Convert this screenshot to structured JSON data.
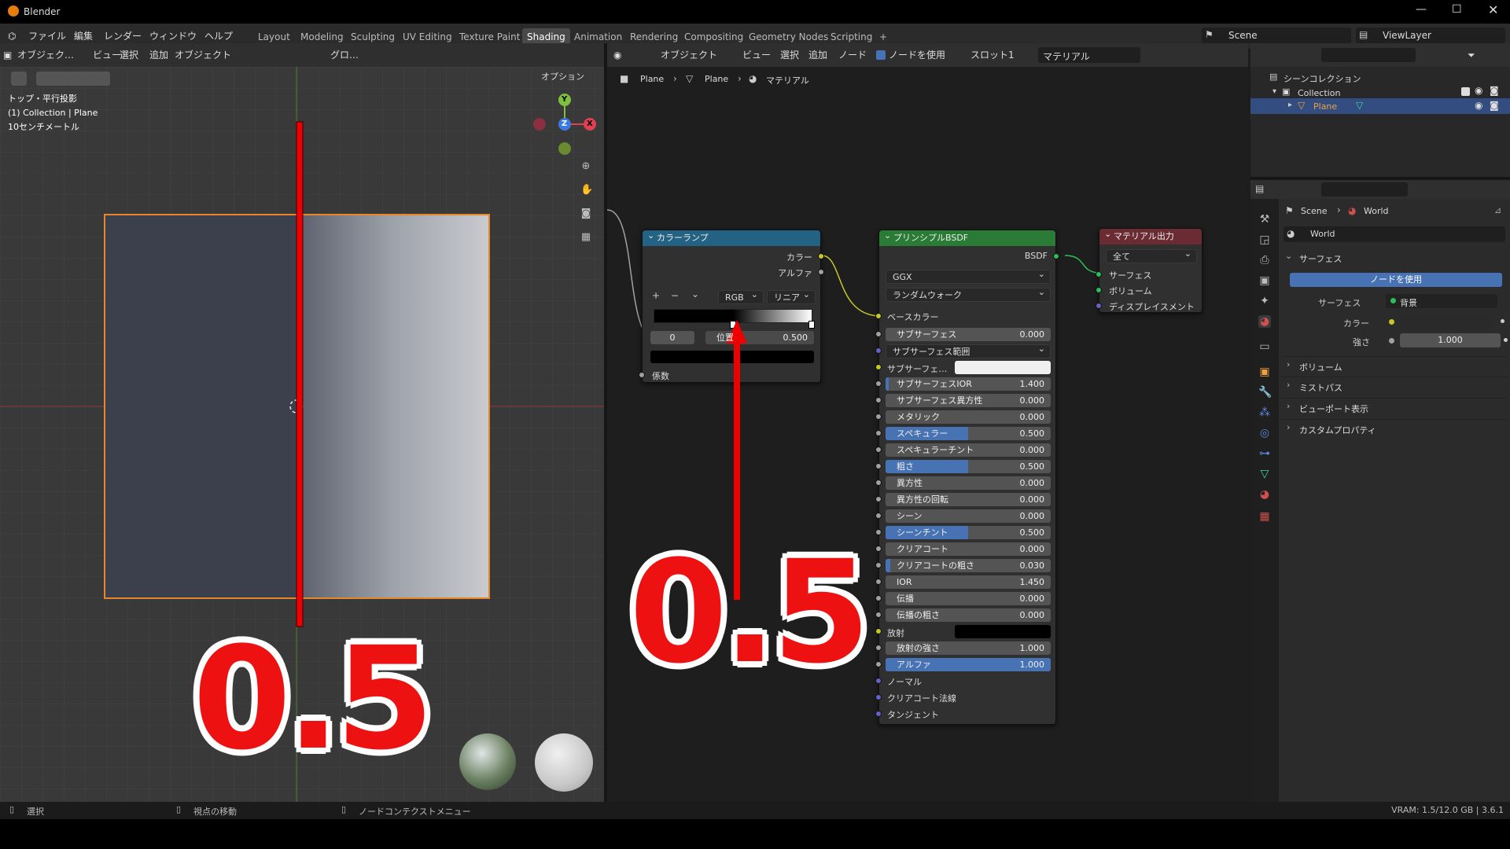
{
  "app": {
    "title": "Blender"
  },
  "menu": {
    "items": [
      "ファイル",
      "編集",
      "レンダー",
      "ウィンドウ",
      "ヘルプ"
    ]
  },
  "workspaces": [
    "Layout",
    "Modeling",
    "Sculpting",
    "UV Editing",
    "Texture Paint",
    "Shading",
    "Animation",
    "Rendering",
    "Compositing",
    "Geometry Nodes",
    "Scripting",
    "+"
  ],
  "top_right": {
    "scene": "Scene",
    "view_layer": "ViewLayer"
  },
  "viewport": {
    "header": {
      "mode": "オブジェク…",
      "view": "ビュー",
      "select": "選択",
      "add": "追加",
      "object": "オブジェクト",
      "transform": "グロ…",
      "options": "オプション"
    },
    "info_lines": [
      "トップ・平行投影",
      "(1) Collection | Plane",
      "10センチメートル"
    ],
    "gizmo": {
      "y": "Y",
      "z": "Z",
      "x": "X"
    }
  },
  "node_editor": {
    "header": {
      "object": "オブジェクト",
      "view": "ビュー",
      "select": "選択",
      "add": "追加",
      "node": "ノード",
      "use_nodes": "ノードを使用",
      "slot": "スロット1",
      "material": "マテリアル"
    },
    "breadcrumb": [
      "Plane",
      "Plane",
      "マテリアル"
    ]
  },
  "color_ramp": {
    "title": "カラーランプ",
    "out_color": "カラー",
    "out_alpha": "アルファ",
    "mode": "RGB",
    "interp": "リニア",
    "index": "0",
    "pos_label": "位置",
    "pos_value": "0.500",
    "in_fac": "係数"
  },
  "bsdf": {
    "title": "プリンシプルBSDF",
    "out": "BSDF",
    "dist": "GGX",
    "sss_method": "ランダムウォーク",
    "base_color": "ベースカラー",
    "rows": [
      {
        "label": "サブサーフェス",
        "value": "0.000",
        "fill": 0
      },
      {
        "label": "サブサーフェス範囲",
        "value": "",
        "fill": 0,
        "dropdown": true
      },
      {
        "label": "サブサーフェ…",
        "value": "",
        "color": "#f0f0f0"
      },
      {
        "label": "サブサーフェスIOR",
        "value": "1.400",
        "fill": 0.02
      },
      {
        "label": "サブサーフェス異方性",
        "value": "0.000",
        "fill": 0
      },
      {
        "label": "メタリック",
        "value": "0.000",
        "fill": 0
      },
      {
        "label": "スペキュラー",
        "value": "0.500",
        "fill": 0.5
      },
      {
        "label": "スペキュラーチント",
        "value": "0.000",
        "fill": 0
      },
      {
        "label": "粗さ",
        "value": "0.500",
        "fill": 0.5
      },
      {
        "label": "異方性",
        "value": "0.000",
        "fill": 0
      },
      {
        "label": "異方性の回転",
        "value": "0.000",
        "fill": 0
      },
      {
        "label": "シーン",
        "value": "0.000",
        "fill": 0
      },
      {
        "label": "シーンチント",
        "value": "0.500",
        "fill": 0.5
      },
      {
        "label": "クリアコート",
        "value": "0.000",
        "fill": 0
      },
      {
        "label": "クリアコートの粗さ",
        "value": "0.030",
        "fill": 0.03
      },
      {
        "label": "IOR",
        "value": "1.450",
        "fill": 0
      },
      {
        "label": "伝播",
        "value": "0.000",
        "fill": 0
      },
      {
        "label": "伝播の粗さ",
        "value": "0.000",
        "fill": 0
      },
      {
        "label": "放射",
        "value": "",
        "color": "#000000"
      },
      {
        "label": "放射の強さ",
        "value": "1.000",
        "fill": 0
      },
      {
        "label": "アルファ",
        "value": "1.000",
        "fill": 1.0
      }
    ],
    "extra": [
      "ノーマル",
      "クリアコート法線",
      "タンジェント"
    ]
  },
  "mat_output": {
    "title": "マテリアル出力",
    "target": "全て",
    "inputs": [
      "サーフェス",
      "ボリューム",
      "ディスプレイスメント"
    ]
  },
  "outliner": {
    "scene_collection": "シーンコレクション",
    "collection": "Collection",
    "plane": "Plane"
  },
  "properties": {
    "crumb_scene": "Scene",
    "crumb_world": "World",
    "world_name": "World",
    "surface_header": "サーフェス",
    "use_nodes": "ノードを使用",
    "surface_label": "サーフェス",
    "surface_value": "背景",
    "color_label": "カラー",
    "strength_label": "強さ",
    "strength_value": "1.000",
    "panels": [
      "ボリューム",
      "ミストパス",
      "ビューポート表示",
      "カスタムプロパティ"
    ]
  },
  "annotation": {
    "left": "0.5",
    "right": "0.5"
  },
  "status": {
    "select": "選択",
    "move": "視点の移動",
    "context": "ノードコンテクストメニュー",
    "vram": "VRAM: 1.5/12.0 GB | 3.6.1"
  }
}
